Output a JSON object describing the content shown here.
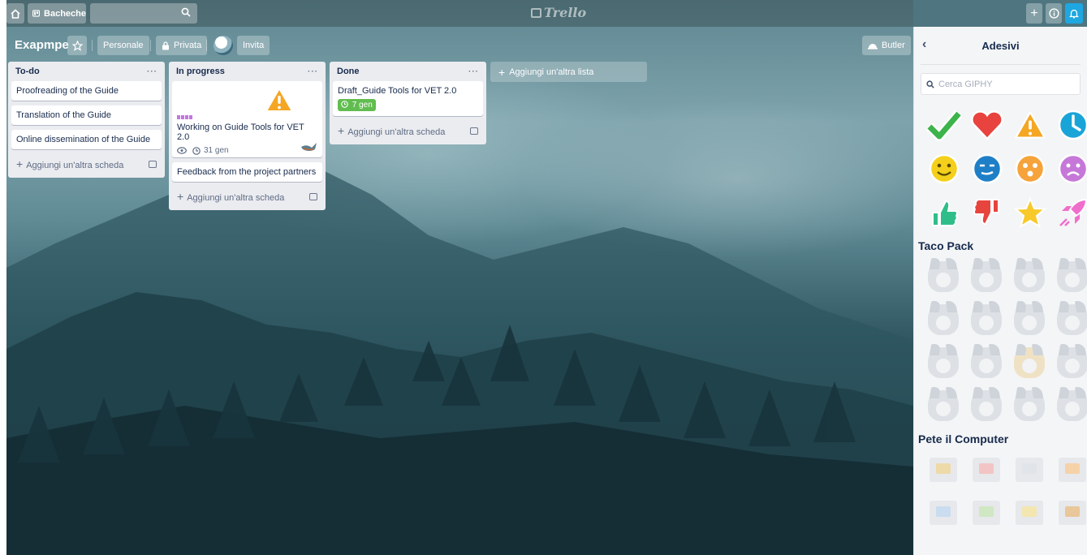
{
  "topbar": {
    "home_icon": "home-icon",
    "boards_label": "Bacheche",
    "search_icon": "search-icon",
    "logo_text": "Trello",
    "add_icon": "plus-icon",
    "info_icon": "info-icon",
    "bell_icon": "bell-icon"
  },
  "board": {
    "title": "Exapmpe",
    "star_icon": "star-icon",
    "team_label": "Personale",
    "visibility_label": "Privata",
    "invite_label": "Invita",
    "butler_label": "Butler"
  },
  "lists": [
    {
      "title": "To-do",
      "menu": "···",
      "cards": [
        {
          "title": "Proofreading of the Guide"
        },
        {
          "title": "Translation of the Guide"
        },
        {
          "title": "Online dissemination of the Guide"
        }
      ],
      "add_card": "Aggiungi un'altra scheda"
    },
    {
      "title": "In progress",
      "menu": "···",
      "cards": [
        {
          "title": "Working on Guide Tools for VET 2.0",
          "date": "31 gen",
          "sticker": "warning-icon"
        },
        {
          "title": "Feedback from the project partners"
        }
      ],
      "add_card": "Aggiungi un'altra scheda"
    },
    {
      "title": "Done",
      "menu": "···",
      "cards": [
        {
          "title": "Draft_Guide Tools for VET 2.0",
          "date": "7 gen"
        }
      ],
      "add_card": "Aggiungi un'altra scheda"
    }
  ],
  "add_list_label": "Aggiungi un'altra lista",
  "sidebar": {
    "title": "Adesivi",
    "search_placeholder": "Cerca GIPHY",
    "section_taco": "Taco Pack",
    "section_pete": "Pete il Computer"
  },
  "colors": {
    "accent_green": "#61bd4f",
    "list_bg": "#ebecf0",
    "topbar_action": "#61bd4f"
  }
}
